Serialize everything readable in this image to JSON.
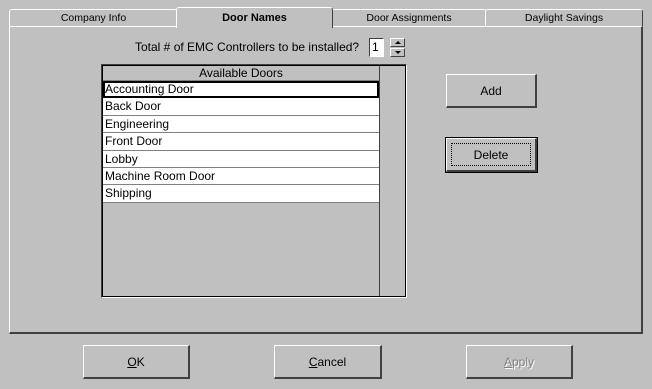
{
  "tabs": [
    {
      "label": "Company Info",
      "active": false
    },
    {
      "label": "Door Names",
      "active": true
    },
    {
      "label": "Door Assignments",
      "active": false
    },
    {
      "label": "Daylight Savings",
      "active": false
    }
  ],
  "controllers": {
    "prompt": "Total # of EMC Controllers to be installed?",
    "value": "1"
  },
  "doors_list": {
    "header": "Available Doors",
    "items": [
      "Accounting Door",
      "Back Door",
      "Engineering",
      "Front Door",
      "Lobby",
      "Machine Room Door",
      "Shipping"
    ],
    "selected_index": 0
  },
  "side_buttons": {
    "add": "Add",
    "delete": "Delete"
  },
  "footer": {
    "ok": "OK",
    "cancel": "Cancel",
    "apply": "Apply"
  }
}
